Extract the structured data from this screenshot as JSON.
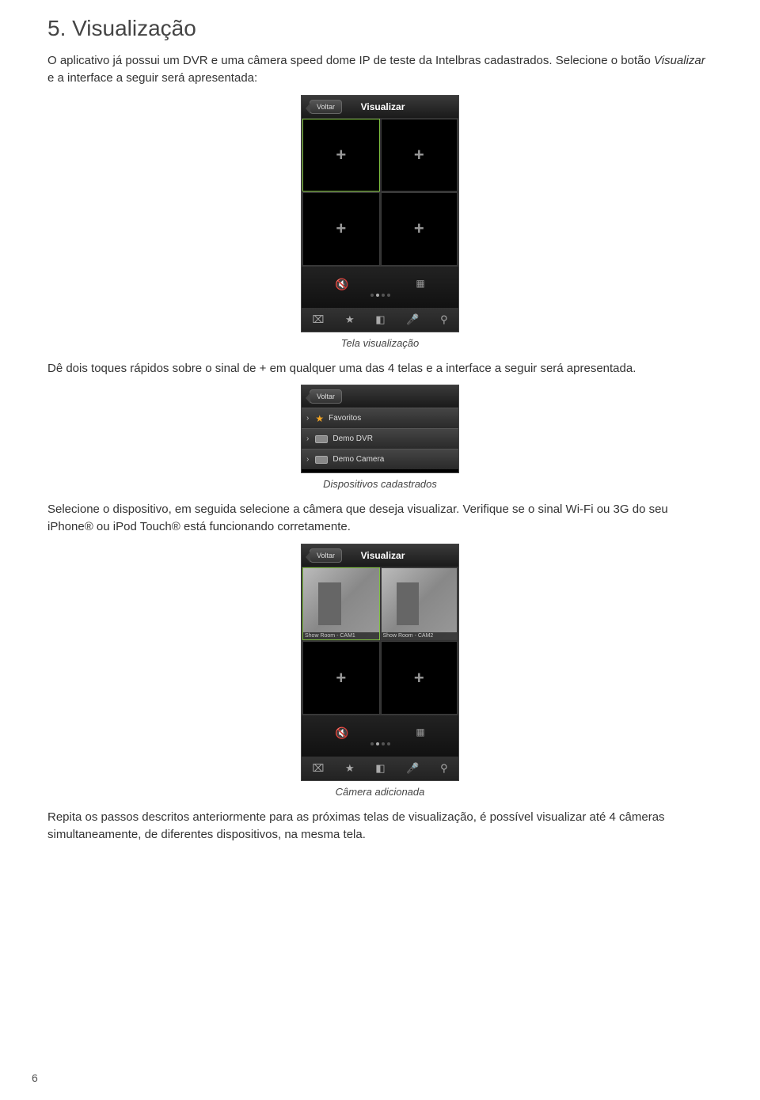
{
  "heading": "5. Visualização",
  "para1_part1": "O aplicativo já possui um DVR e uma câmera speed dome IP de teste da Intelbras cadastrados. Selecione o botão ",
  "para1_italic": "Visualizar",
  "para1_part2": " e a interface a seguir será apresentada:",
  "screen1": {
    "back": "Voltar",
    "title": "Visualizar"
  },
  "caption1": "Tela visualização",
  "para2": "Dê dois toques rápidos sobre o sinal de + em qualquer uma das 4 telas e a interface a seguir será apresentada.",
  "screen2": {
    "back": "Voltar",
    "items": [
      {
        "label": "Favoritos",
        "type": "star"
      },
      {
        "label": "Demo DVR",
        "type": "dvr"
      },
      {
        "label": "Demo Camera",
        "type": "dvr"
      }
    ]
  },
  "caption2": "Dispositivos cadastrados",
  "para3": "Selecione o dispositivo, em seguida selecione a câmera que deseja visualizar. Verifique se o sinal Wi-Fi ou 3G do seu iPhone® ou iPod Touch® está funcionando corretamente.",
  "screen3": {
    "back": "Voltar",
    "title": "Visualizar",
    "cam1": "Show Room - CAM1",
    "cam2": "Show Room - CAM2"
  },
  "caption3": "Câmera adicionada",
  "para4": "Repita os passos descritos anteriormente para as próximas telas de visualização, é possível visualizar até 4 câmeras simultaneamente, de diferentes dispositivos, na mesma tela.",
  "pagenum": "6"
}
